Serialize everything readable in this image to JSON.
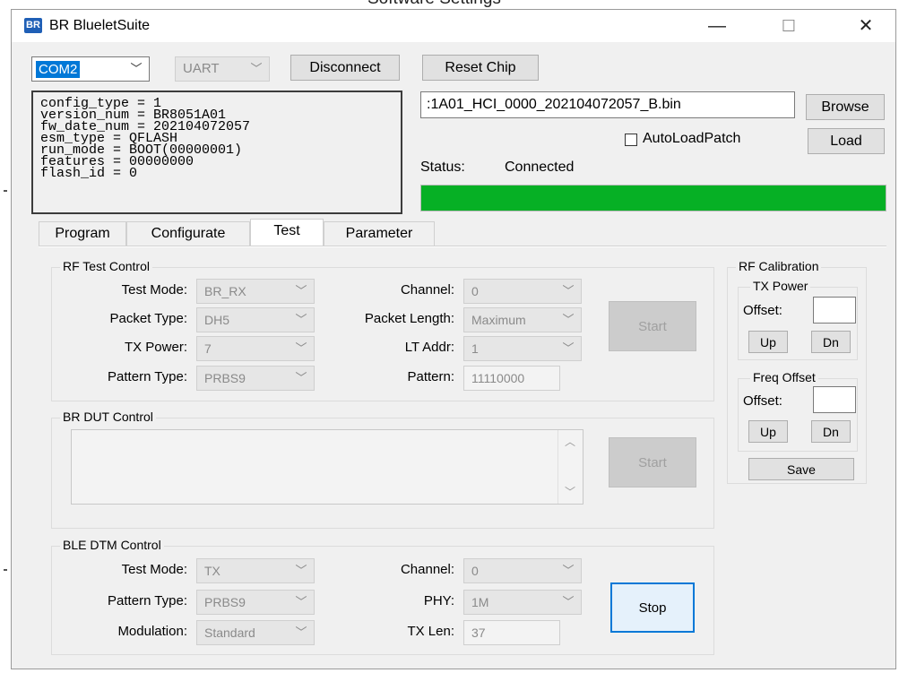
{
  "background_title": "Software Settings",
  "window": {
    "title": "BR BlueletSuite",
    "icon_text": "BR",
    "minimize": "—",
    "maximize": "☐",
    "close": "✕"
  },
  "toolbar": {
    "com_port": "COM2",
    "interface": "UART",
    "disconnect_label": "Disconnect",
    "reset_label": "Reset Chip"
  },
  "chip_info": "config_type = 1\nversion_num = BR8051A01\nfw_date_num = 202104072057\nesm_type = QFLASH\nrun_mode = BOOT(00000001)\nfeatures = 00000000\nflash_id = 0",
  "patch": {
    "file": ":1A01_HCI_0000_202104072057_B.bin",
    "browse_label": "Browse",
    "autoload_label": "AutoLoadPatch",
    "autoload_checked": false,
    "load_label": "Load"
  },
  "status": {
    "label": "Status:",
    "value": "Connected",
    "progress": 1.0,
    "progress_color": "#06b025"
  },
  "tabs": [
    {
      "label": "Program"
    },
    {
      "label": "Configurate"
    },
    {
      "label": "Test",
      "active": true
    },
    {
      "label": "Parameter"
    }
  ],
  "rf_test": {
    "title": "RF Test Control",
    "test_mode_label": "Test Mode:",
    "test_mode": "BR_RX",
    "packet_type_label": "Packet Type:",
    "packet_type": "DH5",
    "tx_power_label": "TX Power:",
    "tx_power": "7",
    "pattern_type_label": "Pattern Type:",
    "pattern_type": "PRBS9",
    "channel_label": "Channel:",
    "channel": "0",
    "packet_length_label": "Packet Length:",
    "packet_length": "Maximum",
    "lt_addr_label": "LT Addr:",
    "lt_addr": "1",
    "pattern_label": "Pattern:",
    "pattern": "11110000",
    "start_label": "Start"
  },
  "br_dut": {
    "title": "BR DUT Control",
    "start_label": "Start"
  },
  "ble_dtm": {
    "title": "BLE DTM Control",
    "test_mode_label": "Test Mode:",
    "test_mode": "TX",
    "pattern_type_label": "Pattern Type:",
    "pattern_type": "PRBS9",
    "modulation_label": "Modulation:",
    "modulation": "Standard",
    "channel_label": "Channel:",
    "channel": "0",
    "phy_label": "PHY:",
    "phy": "1M",
    "tx_len_label": "TX Len:",
    "tx_len": "37",
    "stop_label": "Stop"
  },
  "rf_calibration": {
    "title": "RF Calibration",
    "tx_power_title": "TX Power",
    "tx_offset_label": "Offset:",
    "tx_offset": "",
    "tx_up": "Up",
    "tx_dn": "Dn",
    "freq_title": "Freq Offset",
    "freq_offset_label": "Offset:",
    "freq_offset": "",
    "freq_up": "Up",
    "freq_dn": "Dn",
    "save_label": "Save"
  }
}
